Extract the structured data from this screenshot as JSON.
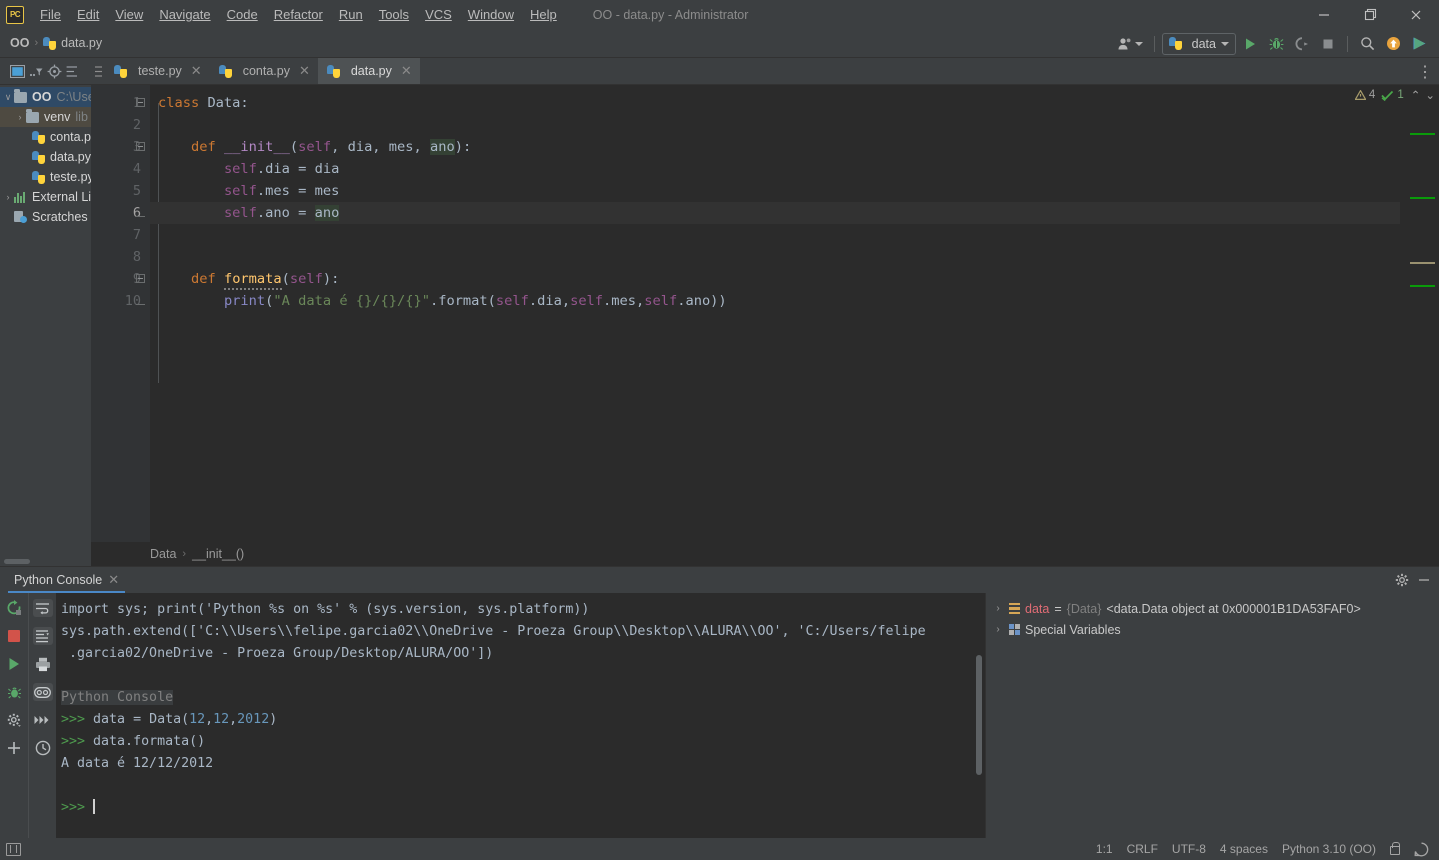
{
  "window": {
    "title": "OO - data.py - Administrator",
    "app_logo": "pycharm-logo",
    "minimize": "−",
    "maximize": "❐",
    "close": "✕"
  },
  "menu": [
    {
      "label": "File"
    },
    {
      "label": "Edit"
    },
    {
      "label": "View"
    },
    {
      "label": "Navigate"
    },
    {
      "label": "Code"
    },
    {
      "label": "Refactor"
    },
    {
      "label": "Run"
    },
    {
      "label": "Tools"
    },
    {
      "label": "VCS"
    },
    {
      "label": "Window"
    },
    {
      "label": "Help"
    }
  ],
  "navbar": {
    "breadcrumb": [
      {
        "label": "OO",
        "icon": "project-folder"
      },
      {
        "label": "data.py",
        "icon": "python-file-icon"
      }
    ],
    "separator": "›"
  },
  "toolbar": {
    "account_label": "account-icon",
    "run_config": "data",
    "run_label": "run-button",
    "debug_label": "debug-button",
    "coverage_label": "run-with-coverage-button",
    "stop_label": "stop-button",
    "search_label": "search-everywhere-button",
    "update_label": "update-project-button",
    "ide_label": "ide-and-plugin-updates-button"
  },
  "project_panel": {
    "header_icons": [
      "project-view-icon",
      "collapse-filter-icon",
      "locate-icon",
      "settings-icon"
    ],
    "tree": [
      {
        "label": "OO",
        "sub": "C:\\User",
        "icon": "folder",
        "arrow": "∨",
        "depth": 0,
        "selected": "blue",
        "bold": true
      },
      {
        "label": "venv",
        "sub": "lib",
        "icon": "folder",
        "arrow": "›",
        "depth": 1,
        "selected": "gray",
        "bold": false
      },
      {
        "label": "conta.py",
        "sub": "",
        "icon": "python-file-icon",
        "arrow": "",
        "depth": 2,
        "selected": "",
        "bold": false
      },
      {
        "label": "data.py",
        "sub": "",
        "icon": "python-file-icon",
        "arrow": "",
        "depth": 2,
        "selected": "",
        "bold": false
      },
      {
        "label": "teste.py",
        "sub": "",
        "icon": "python-file-icon",
        "arrow": "",
        "depth": 2,
        "selected": "",
        "bold": false
      },
      {
        "label": "External Lib",
        "sub": "",
        "icon": "library-icon",
        "arrow": "›",
        "depth": 0,
        "selected": "",
        "bold": false
      },
      {
        "label": "Scratches a",
        "sub": "",
        "icon": "scratches-icon",
        "arrow": "",
        "depth": 0,
        "selected": "",
        "bold": false
      }
    ]
  },
  "editor": {
    "tabs": [
      {
        "label": "teste.py",
        "active": false,
        "close": "✕"
      },
      {
        "label": "conta.py",
        "active": false,
        "close": "✕"
      },
      {
        "label": "data.py",
        "active": true,
        "close": "✕"
      }
    ],
    "more_options": "⋮",
    "inspection": {
      "warning_icon": "warning-triangle-icon",
      "warning_count": "4",
      "ok_icon": "inspection-ok-icon",
      "ok_count": "1",
      "prev": "⌃",
      "next": "⌄"
    },
    "line_numbers": [
      "1",
      "2",
      "3",
      "4",
      "5",
      "6",
      "7",
      "8",
      "9",
      "10"
    ],
    "current_line": 6,
    "lines": [
      {
        "n": 1,
        "tokens": [
          {
            "t": "class",
            "c": "k"
          },
          {
            "t": " ",
            "c": "plain"
          },
          {
            "t": "Data",
            "c": "plain"
          },
          {
            "t": ":",
            "c": "plain"
          }
        ]
      },
      {
        "n": 2,
        "tokens": []
      },
      {
        "n": 3,
        "tokens": [
          {
            "t": "    ",
            "c": "plain"
          },
          {
            "t": "def",
            "c": "k"
          },
          {
            "t": " ",
            "c": "plain"
          },
          {
            "t": "__init__",
            "c": "dunder"
          },
          {
            "t": "(",
            "c": "plain"
          },
          {
            "t": "self",
            "c": "selfw"
          },
          {
            "t": ", dia, mes, ",
            "c": "param"
          },
          {
            "t": "ano",
            "c": "hlbox"
          },
          {
            "t": "):",
            "c": "plain"
          }
        ]
      },
      {
        "n": 4,
        "tokens": [
          {
            "t": "        ",
            "c": "plain"
          },
          {
            "t": "self",
            "c": "selfw"
          },
          {
            "t": ".dia = dia",
            "c": "plain"
          }
        ]
      },
      {
        "n": 5,
        "tokens": [
          {
            "t": "        ",
            "c": "plain"
          },
          {
            "t": "self",
            "c": "selfw"
          },
          {
            "t": ".mes = mes",
            "c": "plain"
          }
        ]
      },
      {
        "n": 6,
        "tokens": [
          {
            "t": "        ",
            "c": "plain"
          },
          {
            "t": "self",
            "c": "selfw"
          },
          {
            "t": ".ano = ",
            "c": "plain"
          },
          {
            "t": "ano",
            "c": "hlbox"
          }
        ]
      },
      {
        "n": 7,
        "tokens": []
      },
      {
        "n": 8,
        "tokens": []
      },
      {
        "n": 9,
        "tokens": [
          {
            "t": "    ",
            "c": "plain"
          },
          {
            "t": "def",
            "c": "k"
          },
          {
            "t": " ",
            "c": "plain"
          },
          {
            "t": "formata",
            "c": "fn wavy"
          },
          {
            "t": "(",
            "c": "plain"
          },
          {
            "t": "self",
            "c": "selfw"
          },
          {
            "t": "):",
            "c": "plain"
          }
        ]
      },
      {
        "n": 10,
        "tokens": [
          {
            "t": "        ",
            "c": "plain"
          },
          {
            "t": "print",
            "c": "bi"
          },
          {
            "t": "(",
            "c": "plain"
          },
          {
            "t": "\"A data é {}/{}/{}\"",
            "c": "str"
          },
          {
            "t": ".format(",
            "c": "plain"
          },
          {
            "t": "self",
            "c": "selfw"
          },
          {
            "t": ".dia,",
            "c": "plain"
          },
          {
            "t": "self",
            "c": "selfw"
          },
          {
            "t": ".mes,",
            "c": "plain"
          },
          {
            "t": "self",
            "c": "selfw"
          },
          {
            "t": ".ano))",
            "c": "plain"
          }
        ]
      }
    ],
    "raw_code": [
      "class Data:",
      "",
      "    def __init__(self, dia, mes, ano):",
      "        self.dia = dia",
      "        self.mes = mes",
      "        self.ano = ano",
      "",
      "",
      "    def formata(self):",
      "        print(\"A data é {}/{}/{}\".format(self.dia,self.mes,self.ano))"
    ],
    "breadcrumbs": [
      {
        "label": "Data"
      },
      {
        "label": "__init__()"
      }
    ],
    "breadcrumb_sep": "›"
  },
  "console": {
    "tab_label": "Python Console",
    "tab_close": "✕",
    "settings_icon": "gear-icon",
    "minimize_icon": "minimize-icon",
    "toolbar_left": [
      "rerun-icon",
      "stop-icon",
      "execute-icon",
      "debug-console-icon",
      "settings-icon",
      "add-icon"
    ],
    "toolbar_right": [
      "soft-wrap-icon",
      "scroll-to-end-icon",
      "print-icon",
      "show-variables-icon",
      "show-queue-icon",
      "history-icon"
    ],
    "output": [
      {
        "text": "import sys; print('Python %s on %s' % (sys.version, sys.platform))",
        "style": "plain"
      },
      {
        "text": "sys.path.extend(['C:\\\\Users\\\\felipe.garcia02\\\\OneDrive - Proeza Group\\\\Desktop\\\\ALURA\\\\OO', 'C:/Users/felipe",
        "style": "plain"
      },
      {
        "text": " .garcia02/OneDrive - Proeza Group/Desktop/ALURA/OO'])",
        "style": "plain"
      },
      {
        "text": "",
        "style": "plain"
      },
      {
        "text": "Python Console",
        "style": "highlight"
      },
      {
        "text": ">>> data = Data(12,12,2012)",
        "style": "prompt-numbers"
      },
      {
        "text": ">>> data.formata()",
        "style": "prompt"
      },
      {
        "text": "A data é 12/12/2012",
        "style": "plain"
      },
      {
        "text": "",
        "style": "plain"
      },
      {
        "text": ">>> ",
        "style": "prompt-cursor"
      }
    ]
  },
  "variables": {
    "rows": [
      {
        "arrow": "›",
        "icon": "variable-icon",
        "name": "data",
        "eq": " = ",
        "type": "{Data}",
        "value": "<data.Data object at 0x000001B1DA53FAF0>"
      },
      {
        "arrow": "›",
        "icon": "special-variables-icon",
        "name": "Special Variables",
        "eq": "",
        "type": "",
        "value": ""
      }
    ]
  },
  "statusbar": {
    "layout_icon": "layout-toggle-icon",
    "position": "1:1",
    "line_separator": "CRLF",
    "encoding": "UTF-8",
    "indent": "4 spaces",
    "interpreter": "Python 3.10 (OO)",
    "lock_icon": "lock-icon",
    "notification_icon": "notification-icon"
  },
  "colors": {
    "bg_chrome": "#3c3f41",
    "bg_editor": "#2b2b2b",
    "bg_gutter": "#313335",
    "accent_blue": "#4a88c7",
    "keyword": "#cc7832",
    "string": "#6a8759",
    "number": "#6897bb",
    "self": "#94558d",
    "function": "#ffc66d",
    "text": "#a9b7c6",
    "prompt_green": "#4e9a4e"
  }
}
